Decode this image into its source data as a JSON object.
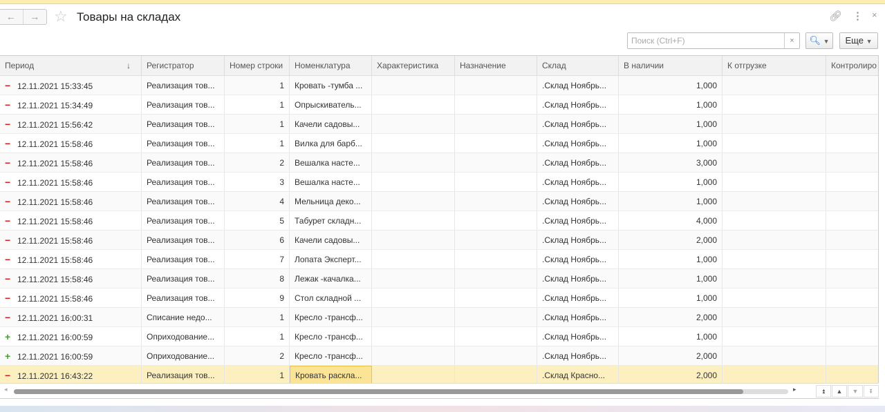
{
  "title": "Товары на складах",
  "search": {
    "placeholder": "Поиск (Ctrl+F)",
    "value": ""
  },
  "more_label": "Еще",
  "columns": [
    "Период",
    "Регистратор",
    "Номер строки",
    "Номенклатура",
    "Характеристика",
    "Назначение",
    "Склад",
    "В наличии",
    "К отгрузке",
    "Контролиро"
  ],
  "rows": [
    {
      "sign": "−",
      "type": "minus",
      "period": "12.11.2021 15:33:45",
      "reg": "Реализация тов...",
      "line": "1",
      "item": "Кровать -тумба ...",
      "wh": ".Склад Ноябрь...",
      "qty": "1,000"
    },
    {
      "sign": "−",
      "type": "minus",
      "period": "12.11.2021 15:34:49",
      "reg": "Реализация тов...",
      "line": "1",
      "item": "Опрыскиватель...",
      "wh": ".Склад Ноябрь...",
      "qty": "1,000"
    },
    {
      "sign": "−",
      "type": "minus",
      "period": "12.11.2021 15:56:42",
      "reg": "Реализация тов...",
      "line": "1",
      "item": "Качели садовы...",
      "wh": ".Склад Ноябрь...",
      "qty": "1,000"
    },
    {
      "sign": "−",
      "type": "minus",
      "period": "12.11.2021 15:58:46",
      "reg": "Реализация тов...",
      "line": "1",
      "item": "Вилка для барб...",
      "wh": ".Склад Ноябрь...",
      "qty": "1,000"
    },
    {
      "sign": "−",
      "type": "minus",
      "period": "12.11.2021 15:58:46",
      "reg": "Реализация тов...",
      "line": "2",
      "item": "Вешалка насте...",
      "wh": ".Склад Ноябрь...",
      "qty": "3,000"
    },
    {
      "sign": "−",
      "type": "minus",
      "period": "12.11.2021 15:58:46",
      "reg": "Реализация тов...",
      "line": "3",
      "item": "Вешалка насте...",
      "wh": ".Склад Ноябрь...",
      "qty": "1,000"
    },
    {
      "sign": "−",
      "type": "minus",
      "period": "12.11.2021 15:58:46",
      "reg": "Реализация тов...",
      "line": "4",
      "item": "Мельница деко...",
      "wh": ".Склад Ноябрь...",
      "qty": "1,000"
    },
    {
      "sign": "−",
      "type": "minus",
      "period": "12.11.2021 15:58:46",
      "reg": "Реализация тов...",
      "line": "5",
      "item": "Табурет складн...",
      "wh": ".Склад Ноябрь...",
      "qty": "4,000"
    },
    {
      "sign": "−",
      "type": "minus",
      "period": "12.11.2021 15:58:46",
      "reg": "Реализация тов...",
      "line": "6",
      "item": "Качели садовы...",
      "wh": ".Склад Ноябрь...",
      "qty": "2,000"
    },
    {
      "sign": "−",
      "type": "minus",
      "period": "12.11.2021 15:58:46",
      "reg": "Реализация тов...",
      "line": "7",
      "item": "Лопата Эксперт...",
      "wh": ".Склад Ноябрь...",
      "qty": "1,000"
    },
    {
      "sign": "−",
      "type": "minus",
      "period": "12.11.2021 15:58:46",
      "reg": "Реализация тов...",
      "line": "8",
      "item": "Лежак -качалка...",
      "wh": ".Склад Ноябрь...",
      "qty": "1,000"
    },
    {
      "sign": "−",
      "type": "minus",
      "period": "12.11.2021 15:58:46",
      "reg": "Реализация тов...",
      "line": "9",
      "item": "Стол складной ...",
      "wh": ".Склад Ноябрь...",
      "qty": "1,000"
    },
    {
      "sign": "−",
      "type": "minus",
      "period": "12.11.2021 16:00:31",
      "reg": "Списание недо...",
      "line": "1",
      "item": "Кресло -трансф...",
      "wh": ".Склад Ноябрь...",
      "qty": "2,000"
    },
    {
      "sign": "+",
      "type": "plus",
      "period": "12.11.2021 16:00:59",
      "reg": "Оприходование...",
      "line": "1",
      "item": "Кресло -трансф...",
      "wh": ".Склад Ноябрь...",
      "qty": "1,000"
    },
    {
      "sign": "+",
      "type": "plus",
      "period": "12.11.2021 16:00:59",
      "reg": "Оприходование...",
      "line": "2",
      "item": "Кресло -трансф...",
      "wh": ".Склад Ноябрь...",
      "qty": "2,000"
    },
    {
      "sign": "−",
      "type": "minus",
      "period": "12.11.2021 16:43:22",
      "reg": "Реализация тов...",
      "line": "1",
      "item": "Кровать раскла...",
      "wh": ".Склад Красно...",
      "qty": "2,000",
      "selected": true
    }
  ]
}
